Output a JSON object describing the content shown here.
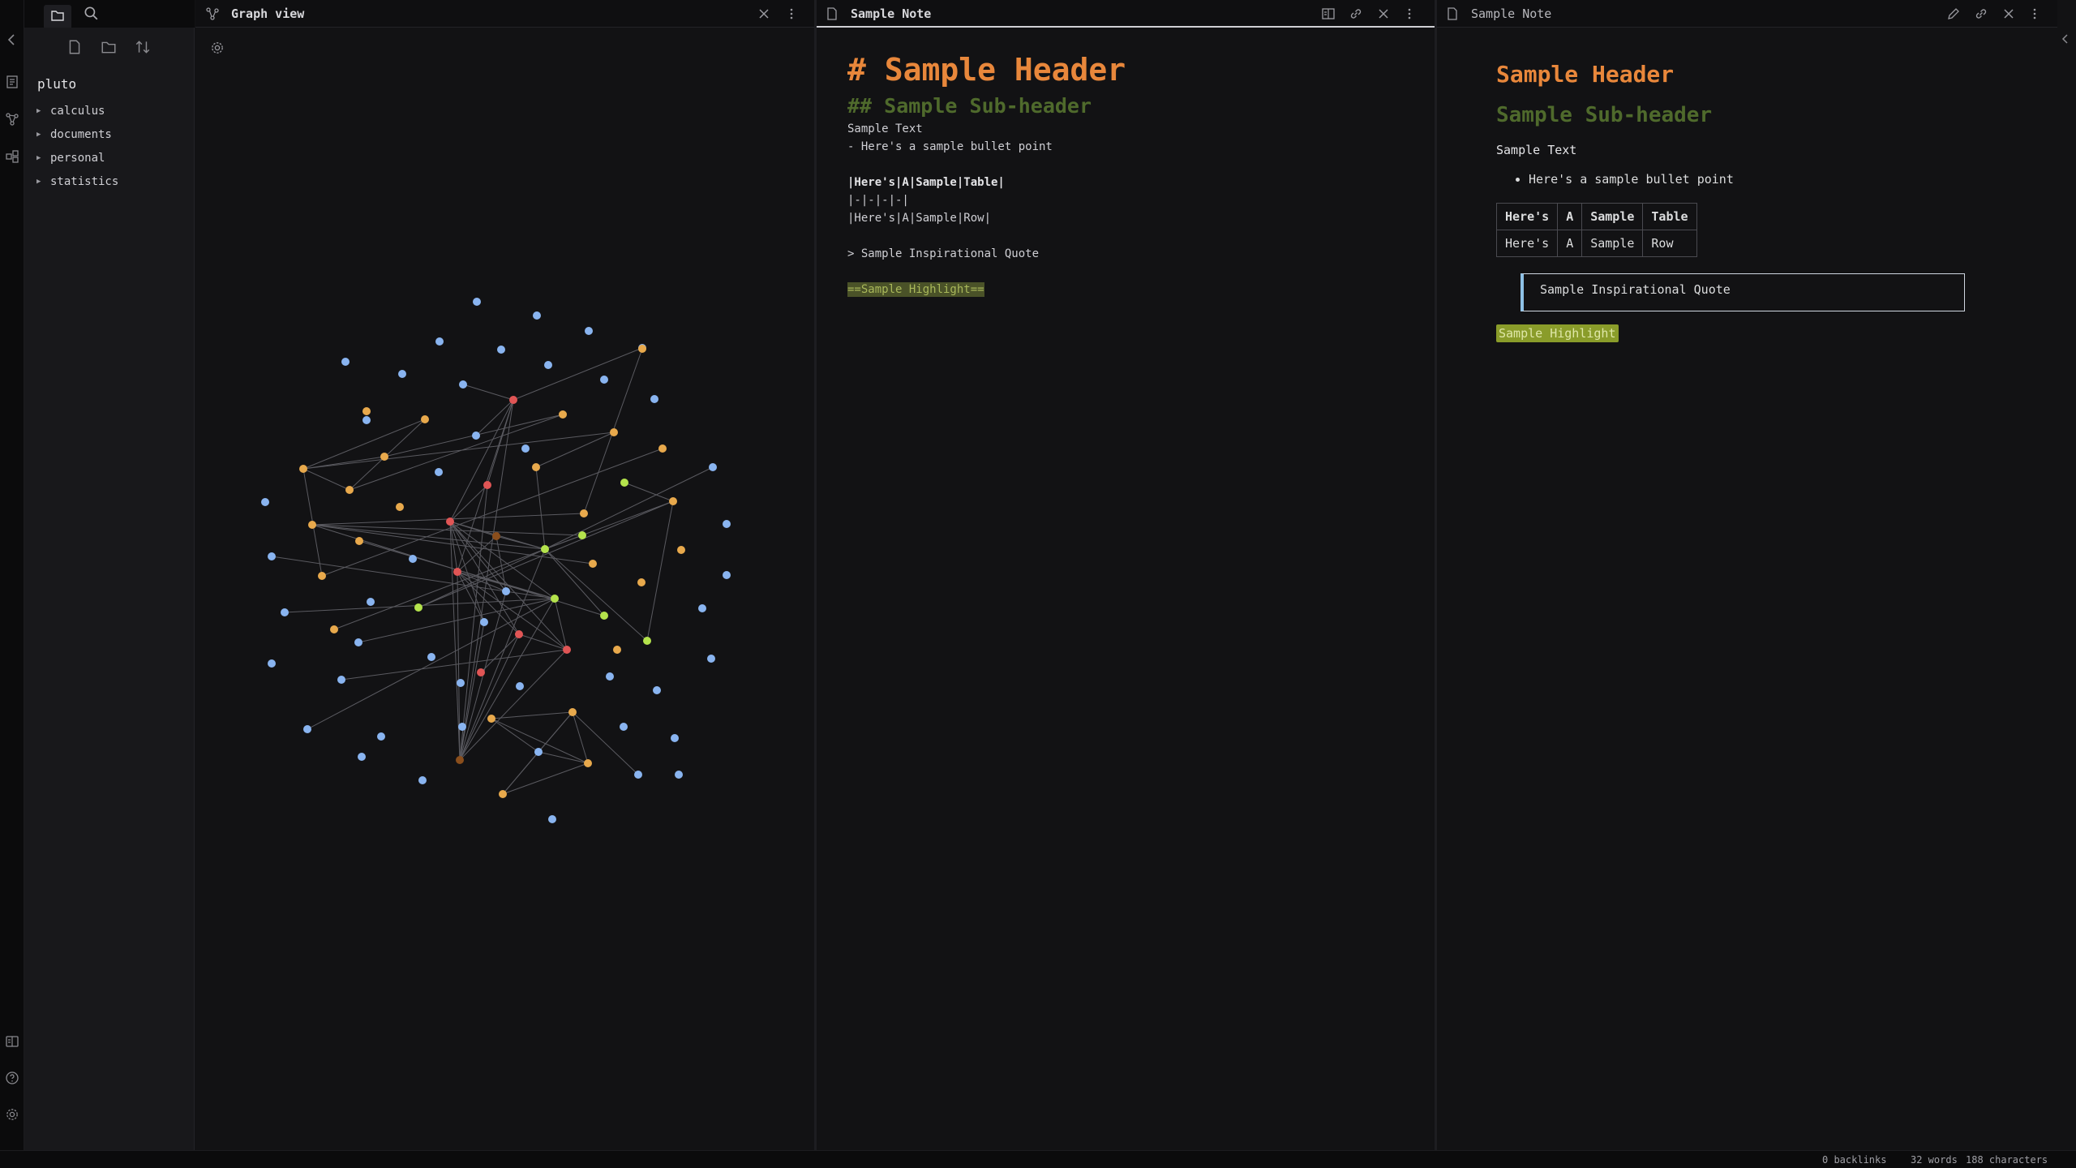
{
  "explorer": {
    "vault_name": "pluto",
    "folders": [
      "calculus",
      "documents",
      "personal",
      "statistics"
    ]
  },
  "panes": {
    "graph": {
      "title": "Graph view"
    },
    "source": {
      "title": "Sample Note"
    },
    "reading": {
      "title": "Sample Note"
    }
  },
  "note_source": {
    "h1": "# Sample Header",
    "h2": "## Sample Sub-header",
    "text": "Sample Text",
    "bullet": "- Here's a sample bullet point",
    "table_header": "|Here's|A|Sample|Table|",
    "table_sep": "|-|-|-|-|",
    "table_row": "|Here's|A|Sample|Row|",
    "quote": "> Sample Inspirational Quote",
    "highlight": "==Sample Highlight=="
  },
  "note_rendered": {
    "h1": "Sample Header",
    "h2": "Sample Sub-header",
    "text": "Sample Text",
    "bullet": "Here's a sample bullet point",
    "table_headers": [
      "Here's",
      "A",
      "Sample",
      "Table"
    ],
    "table_row": [
      "Here's",
      "A",
      "Sample",
      "Row"
    ],
    "quote": "Sample Inspirational Quote",
    "highlight": "Sample Highlight"
  },
  "status": {
    "backlinks": "0 backlinks",
    "words": "32 words",
    "characters": "188 characters"
  },
  "colors": {
    "node_blue": "#89b4f0",
    "node_orange": "#e8a94c",
    "node_red": "#e05555",
    "node_green": "#b4e34c",
    "node_brown": "#8a4e1c",
    "header_orange": "#e8873b",
    "subheader_green": "#4f6a2c"
  }
}
